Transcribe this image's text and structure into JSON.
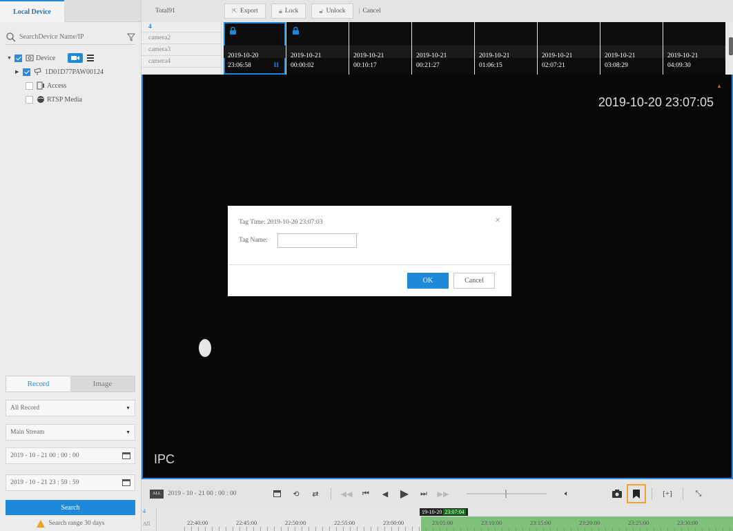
{
  "left": {
    "tab": "Local Device",
    "search_placeholder": "SearchDevice Name/IP",
    "tree": {
      "device": "Device",
      "device_id": "1D01D77PAW00124",
      "access": "Access",
      "rtsp": "RTSP Media"
    },
    "rec_tabs": {
      "record": "Record",
      "image": "Image"
    },
    "record_type": "All Record",
    "stream": "Main Stream",
    "start_time": "2019 - 10 - 21  00 : 00 : 00",
    "end_time": "2019 - 10 - 21  23 : 59 : 59",
    "search_label": "Search",
    "range_note": "Search range 30 days"
  },
  "topbar": {
    "total": "Total91",
    "export": "Export",
    "lock": "Lock",
    "unlock": "Unlock",
    "cancel": "Cancel"
  },
  "camlist": {
    "num": "4",
    "cameras": [
      "camera2",
      "camera3",
      "camera4"
    ]
  },
  "thumbnails": [
    {
      "date": "2019-10-20",
      "time": "23:06:58",
      "locked": true,
      "selected": true
    },
    {
      "date": "2019-10-21",
      "time": "00:00:02",
      "locked": true,
      "selected": false
    },
    {
      "date": "2019-10-21",
      "time": "00:10:17",
      "locked": false,
      "selected": false
    },
    {
      "date": "2019-10-21",
      "time": "00:21:27",
      "locked": false,
      "selected": false
    },
    {
      "date": "2019-10-21",
      "time": "01:06:15",
      "locked": false,
      "selected": false
    },
    {
      "date": "2019-10-21",
      "time": "02:07:21",
      "locked": false,
      "selected": false
    },
    {
      "date": "2019-10-21",
      "time": "03:08:29",
      "locked": false,
      "selected": false
    },
    {
      "date": "2019-10-21",
      "time": "04:09:30",
      "locked": false,
      "selected": false
    }
  ],
  "video": {
    "timestamp": "2019-10-20 23:07:05",
    "osd": "IPC"
  },
  "dialog": {
    "title": "Tag Time: 2019-10-20 23:07:03",
    "name_label": "Tag Name:",
    "name_value": "",
    "ok": "OK",
    "cancel": "Cancel"
  },
  "playbar": {
    "all": "ALL",
    "date": "2019 - 10 - 21  00 : 00 : 00"
  },
  "timeline": {
    "channel": "4",
    "all": "All",
    "cursor_date": "19-10-20",
    "cursor_time": "23:07:04",
    "labels": [
      "22:40:00",
      "22:45:00",
      "22:50:00",
      "22:55:00",
      "23:00:00",
      "23:05:00",
      "23:10:00",
      "23:15:00",
      "23:20:00",
      "23:25:00",
      "23:30:00"
    ]
  },
  "colors": {
    "accent": "#1d89d8",
    "highlight": "#f0a331",
    "record": "#7ec07c"
  }
}
